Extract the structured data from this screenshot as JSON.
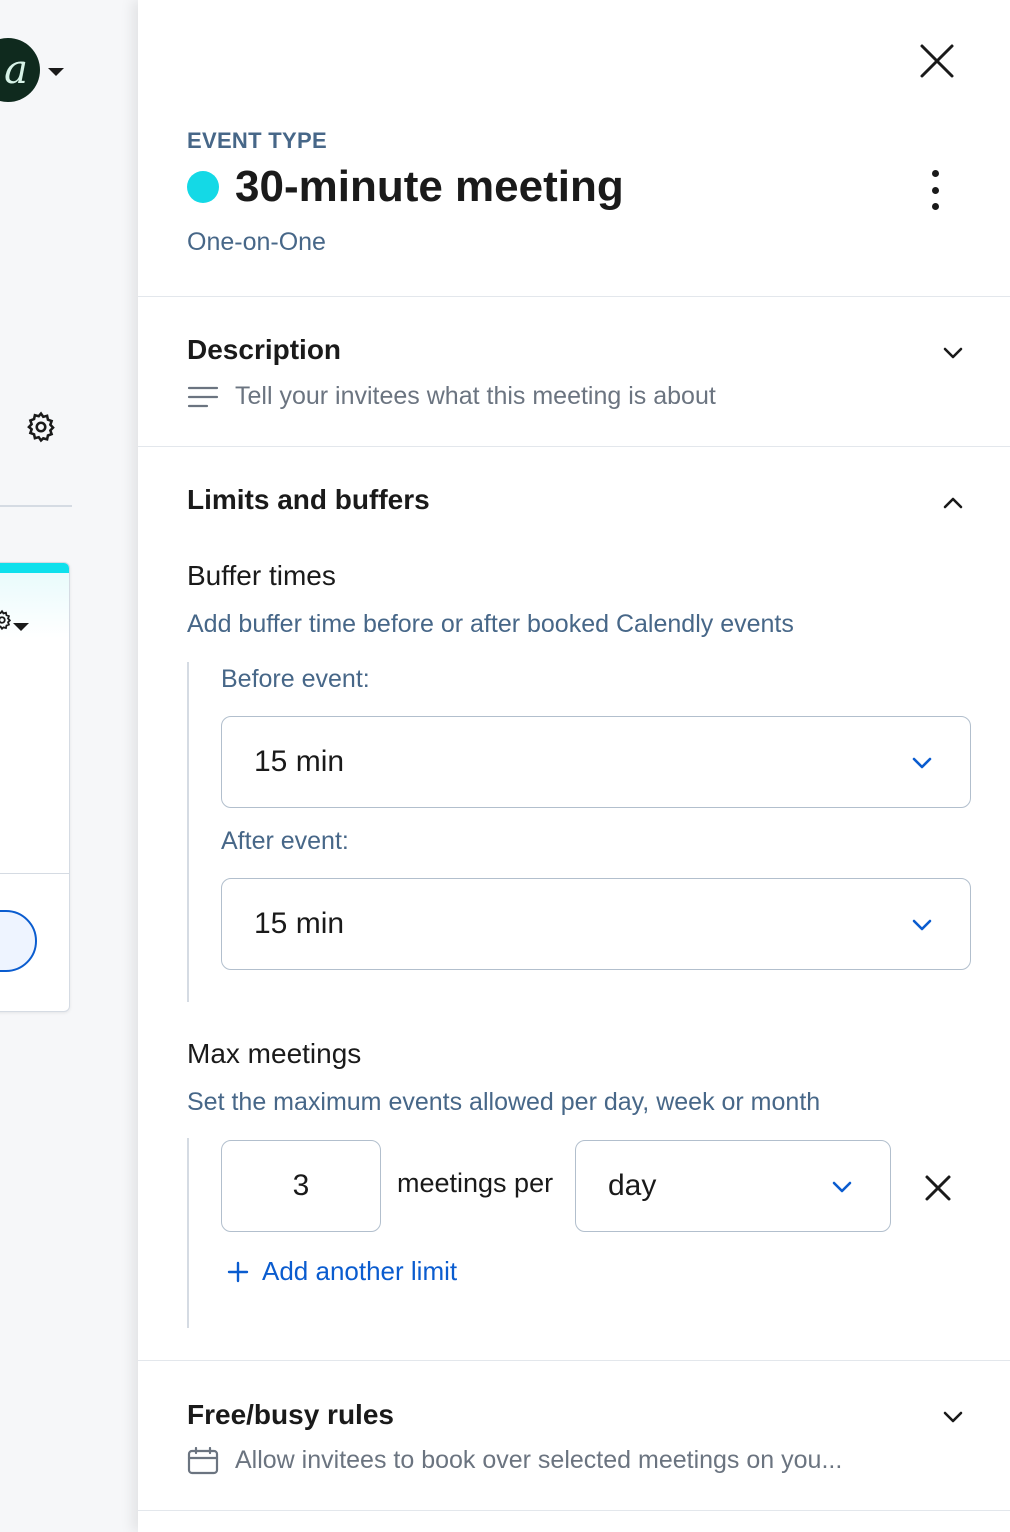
{
  "header": {
    "eyebrow": "EVENT TYPE",
    "title": "30-minute meeting",
    "subtitle": "One-on-One",
    "color_dot": "#14d9e6"
  },
  "left": {
    "avatar_letter": "a"
  },
  "description": {
    "title": "Description",
    "placeholder": "Tell your invitees what this meeting is about"
  },
  "limits": {
    "title": "Limits and buffers",
    "buffer": {
      "title": "Buffer times",
      "desc": "Add buffer time before or after booked Calendly events",
      "before_label": "Before event:",
      "before_value": "15 min",
      "after_label": "After event:",
      "after_value": "15 min"
    },
    "max": {
      "title": "Max meetings",
      "desc": "Set the maximum events allowed per day, week or month",
      "count": "3",
      "per_label": "meetings per",
      "period": "day",
      "add_label": "Add another limit"
    }
  },
  "freebusy": {
    "title": "Free/busy rules",
    "desc": "Allow invitees to book over selected meetings on you..."
  },
  "colors": {
    "accent": "#0a5ccf",
    "muted_blue": "#476788"
  }
}
